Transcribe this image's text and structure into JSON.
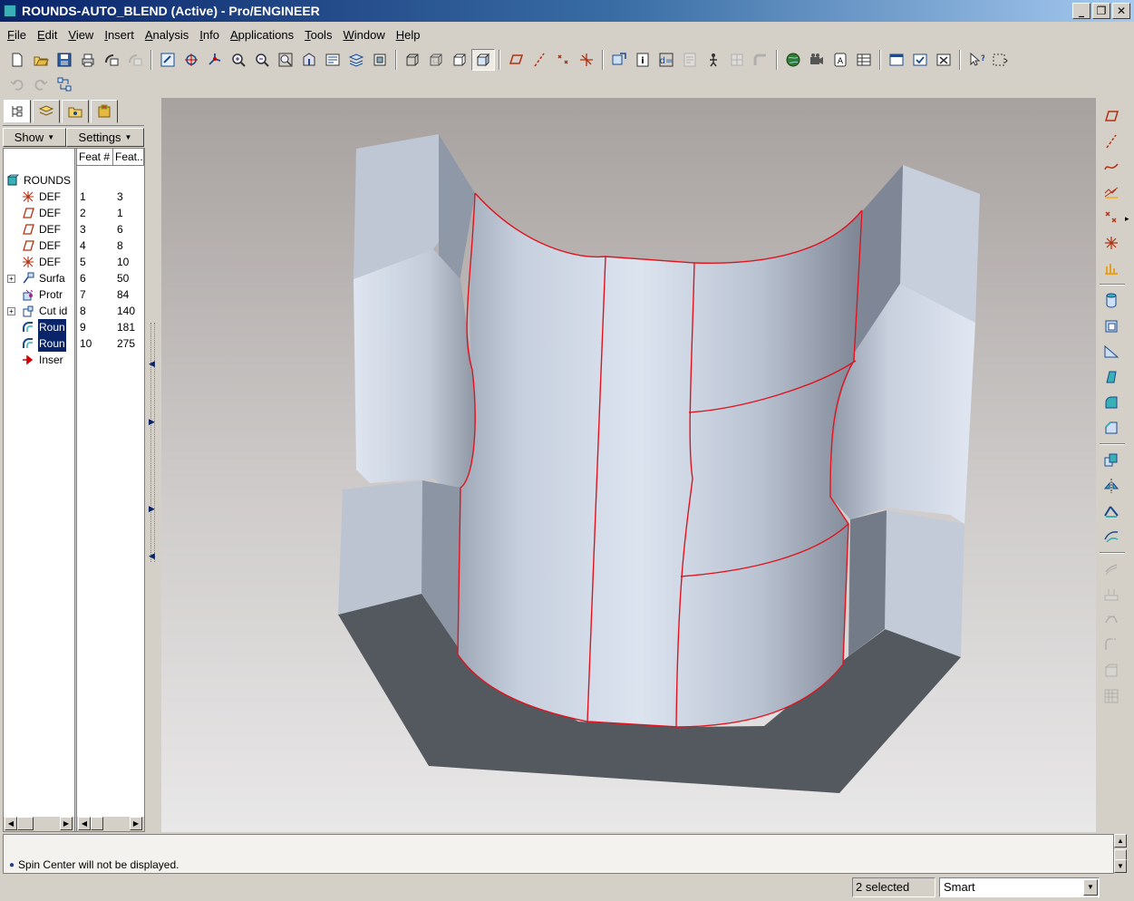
{
  "window": {
    "title": "ROUNDS-AUTO_BLEND (Active) - Pro/ENGINEER",
    "buttons": [
      "minimize",
      "restore",
      "close"
    ]
  },
  "menubar": {
    "items": [
      "File",
      "Edit",
      "View",
      "Insert",
      "Analysis",
      "Info",
      "Applications",
      "Tools",
      "Window",
      "Help"
    ]
  },
  "toolbar": {
    "main": [
      "new-icon",
      "open-icon",
      "save-icon",
      "print-icon",
      "send-mail-icon",
      "send-mail-attach-icon",
      "repaint-icon",
      "spin-center-icon",
      "orient-mode-icon",
      "zoom-in-icon",
      "zoom-out-icon",
      "refit-icon",
      "reorient-icon",
      "saved-views-icon",
      "layers-icon",
      "view-manager-icon",
      "wireframe-icon",
      "hidden-line-icon",
      "no-hidden-icon",
      "shading-icon",
      "datum-planes-display-icon",
      "datum-axes-display-icon",
      "point-display-icon",
      "csys-display-icon",
      "regenerate-icon",
      "info-icon",
      "relations-icon",
      "parameters-icon",
      "model-player-icon",
      "family-table-icon",
      "pipe-icon",
      "model-tree-web-icon",
      "animation-icon",
      "annotation-icon",
      "table-icon",
      "window-icon",
      "activate-window-icon",
      "close-window-icon",
      "context-help-icon",
      "selection-filter-icon"
    ],
    "secondary": [
      "undo-icon",
      "redo-icon",
      "reorder-icon"
    ]
  },
  "navigator": {
    "tabs": [
      "model-tree-tab-icon",
      "layer-tab-icon",
      "folder-browser-tab-icon",
      "favorites-tab-icon"
    ],
    "show_label": "Show",
    "settings_label": "Settings",
    "column_headers": [
      "Feat #",
      "Feat..."
    ],
    "root_label": "ROUNDS",
    "rows": [
      {
        "label": "DEF",
        "num": "1",
        "id": "3",
        "icon": "csys-icon",
        "expand": false,
        "selected": false
      },
      {
        "label": "DEF",
        "num": "2",
        "id": "1",
        "icon": "datum-plane-icon",
        "expand": false,
        "selected": false
      },
      {
        "label": "DEF",
        "num": "3",
        "id": "6",
        "icon": "datum-plane-icon",
        "expand": false,
        "selected": false
      },
      {
        "label": "DEF",
        "num": "4",
        "id": "8",
        "icon": "datum-plane-icon",
        "expand": false,
        "selected": false
      },
      {
        "label": "DEF",
        "num": "5",
        "id": "10",
        "icon": "csys-icon",
        "expand": false,
        "selected": false
      },
      {
        "label": "Surfa",
        "num": "6",
        "id": "50",
        "icon": "surface-icon",
        "expand": true,
        "selected": false
      },
      {
        "label": "Protr",
        "num": "7",
        "id": "84",
        "icon": "protrusion-icon",
        "expand": false,
        "selected": false
      },
      {
        "label": "Cut id",
        "num": "8",
        "id": "140",
        "icon": "cut-icon",
        "expand": true,
        "selected": false
      },
      {
        "label": "Roun",
        "num": "9",
        "id": "181",
        "icon": "round-icon",
        "expand": false,
        "selected": true
      },
      {
        "label": "Roun",
        "num": "10",
        "id": "275",
        "icon": "round-icon",
        "expand": false,
        "selected": true
      },
      {
        "label": "Inser",
        "num": "",
        "id": "",
        "icon": "insert-here-arrow-icon",
        "expand": false,
        "selected": false
      }
    ]
  },
  "right_toolbar": {
    "items": [
      "datum-plane-tool-icon",
      "datum-axis-tool-icon",
      "datum-curve-tool-icon",
      "sketched-curve-tool-icon",
      "datum-point-tool-icon",
      "datum-csys-tool-icon",
      "analysis-feature-icon",
      "hole-tool-icon",
      "shell-tool-icon",
      "rib-tool-icon",
      "draft-tool-icon",
      "round-tool-icon",
      "chamfer-tool-icon",
      "copy-icon",
      "mirror-icon",
      "merge-icon",
      "trim-icon",
      "offset-icon",
      "thicken-icon",
      "intersect-icon",
      "extend-icon",
      "solidify-icon",
      "pattern-icon"
    ]
  },
  "message": {
    "text": "Spin Center will not be displayed."
  },
  "status": {
    "selected": "2 selected",
    "filter": "Smart"
  },
  "colors": {
    "title_start": "#0a246a",
    "title_end": "#a6caf0",
    "selection": "#0a246a",
    "edge_highlight": "#e0141e",
    "part_surface": "#c3cbd9",
    "part_dark": "#54585f"
  }
}
